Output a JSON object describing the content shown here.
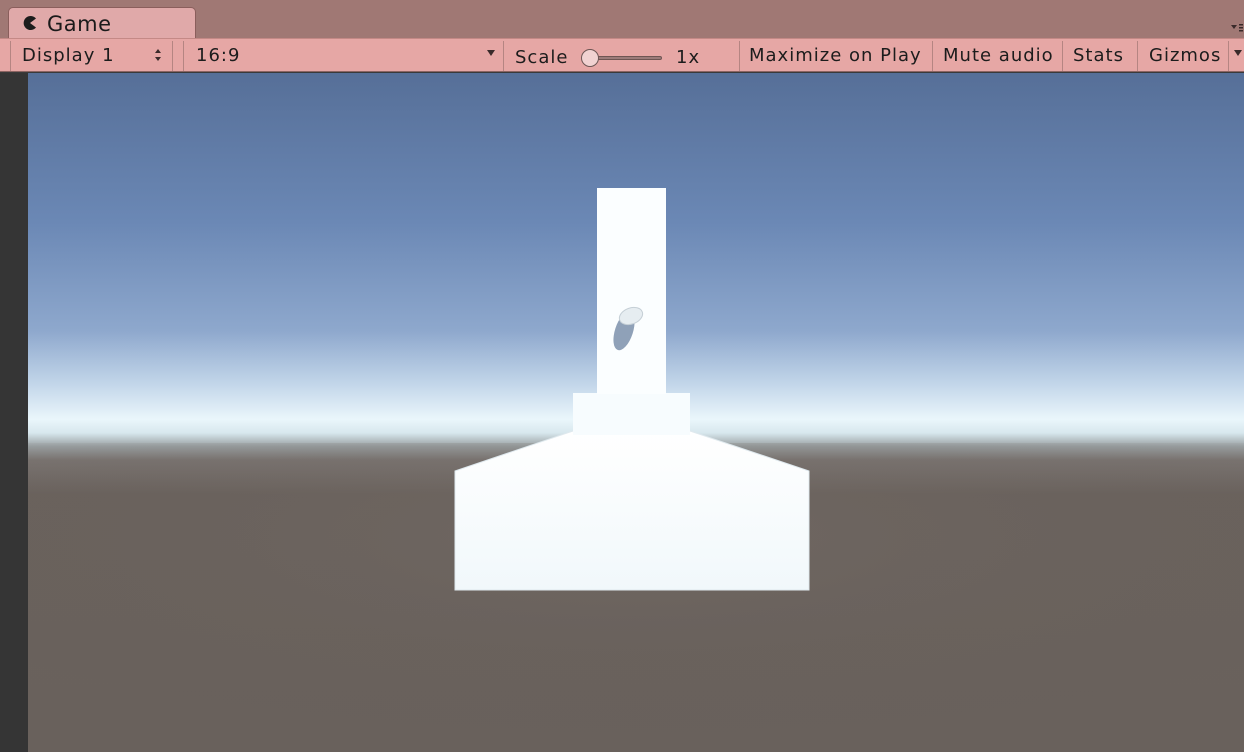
{
  "window": {
    "tab_title": "Game",
    "tab_icon": "pacman-icon"
  },
  "toolbar": {
    "display_label": "Display 1",
    "aspect_label": "16:9",
    "scale_label": "Scale",
    "scale_value_text": "1x",
    "scale_value": 1,
    "maximize_label": "Maximize on Play",
    "mute_label": "Mute audio",
    "stats_label": "Stats",
    "gizmos_label": "Gizmos"
  },
  "colors": {
    "tab_background": "#e0a9a9",
    "toolbar_background": "#e6a7a5",
    "sky_top": "#566f98",
    "horizon": "#eaf6fb",
    "ground": "#69615c",
    "object": "#f6fcff"
  }
}
